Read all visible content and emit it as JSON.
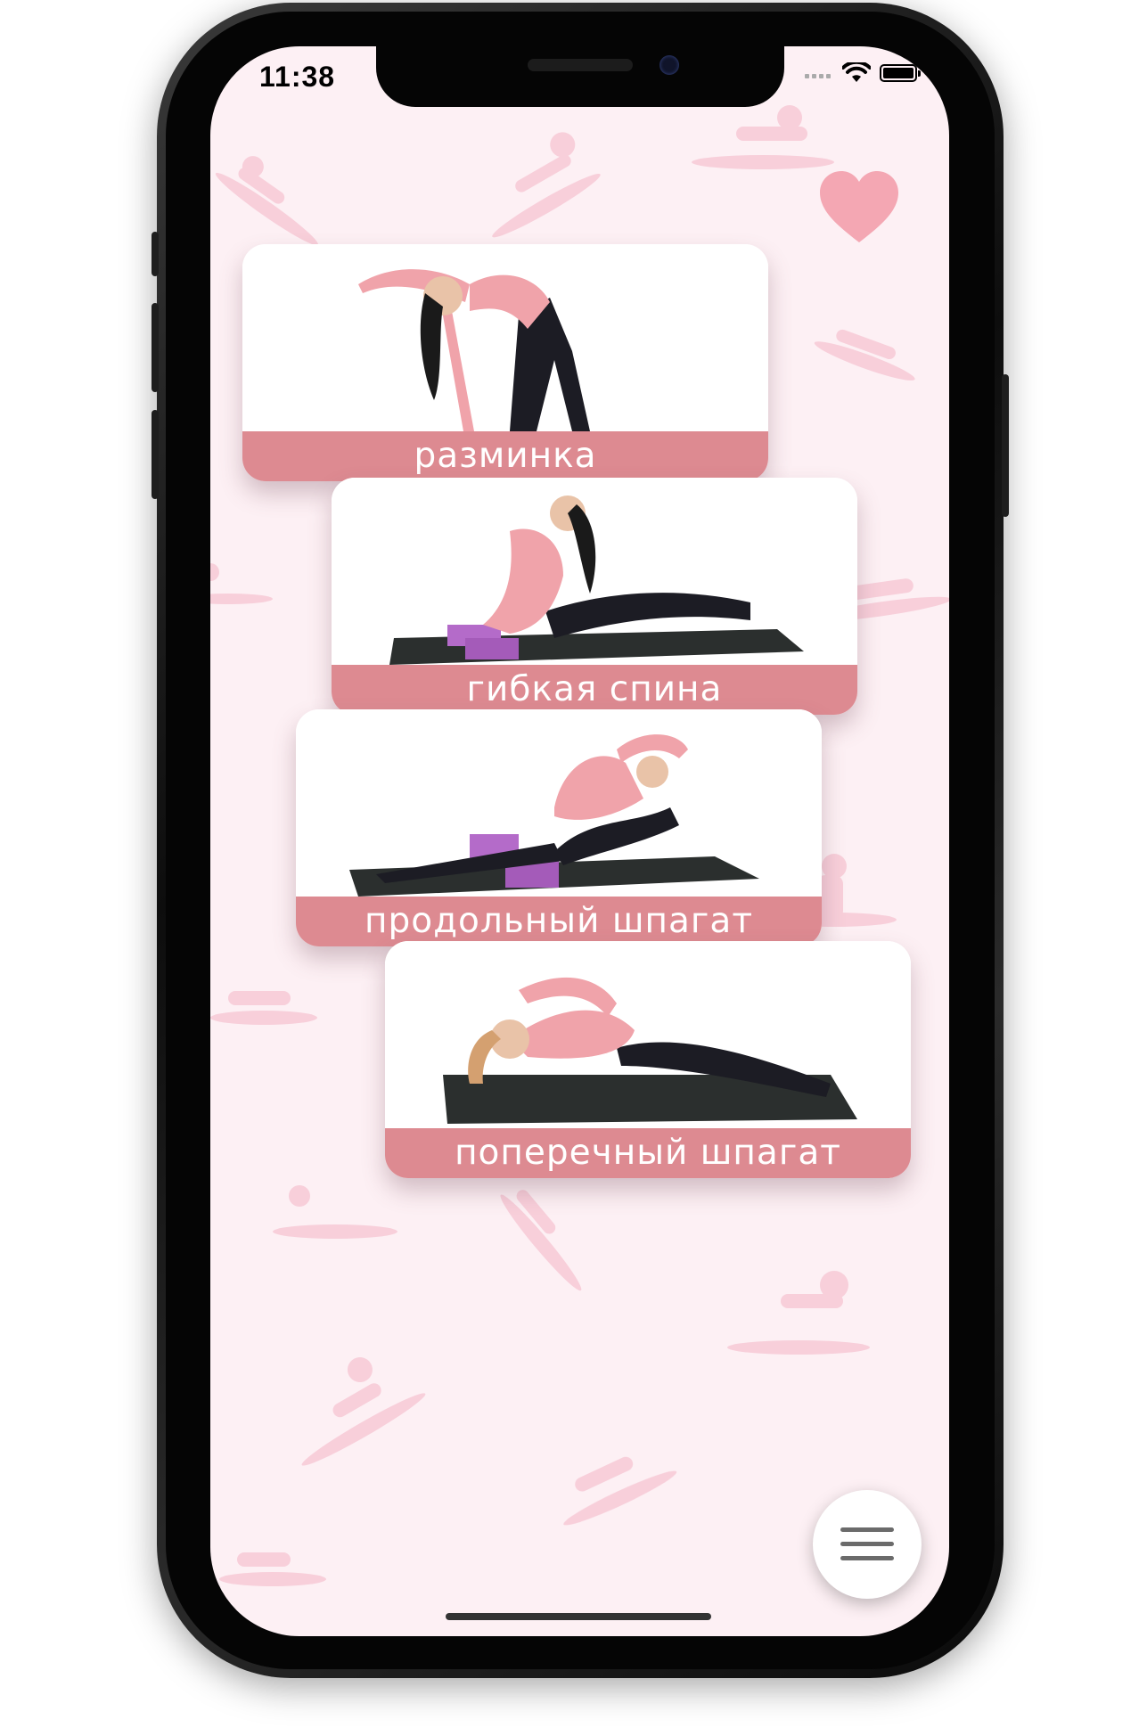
{
  "status_bar": {
    "time": "11:38"
  },
  "cards": [
    {
      "label": "разминка"
    },
    {
      "label": "гибкая спина"
    },
    {
      "label": "продольный шпагат"
    },
    {
      "label": "поперечный шпагат"
    }
  ],
  "icons": {
    "favorite": "heart-icon",
    "menu": "hamburger-menu-icon",
    "wifi": "wifi-icon",
    "battery": "battery-icon",
    "signal": "signal-icon"
  },
  "colors": {
    "accent": "#dd8a91",
    "heart": "#f4a7b3",
    "background": "#fdf0f4",
    "pattern": "#f6c4d2",
    "card_label_text": "#ffffff"
  }
}
